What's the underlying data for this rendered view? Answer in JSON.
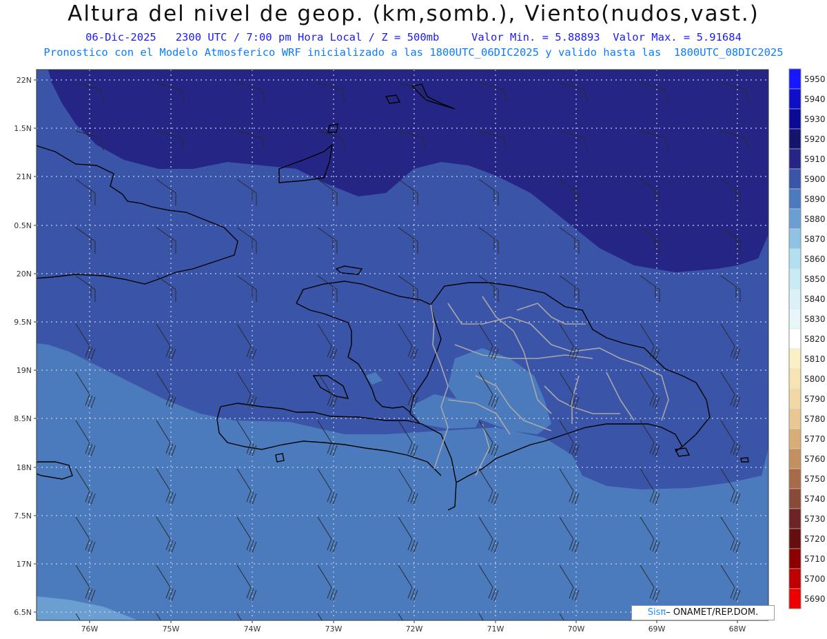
{
  "header": {
    "title": "Altura del nivel de geop. (km,somb.), Viento(nudos,vast.)",
    "line1": "06-Dic-2025   2300 UTC / 7:00 pm Hora Local / Z = 500mb     Valor Min. = 5.88893  Valor Max. = 5.91684",
    "line2": "Pronostico con el Modelo Atmosferico WRF inicializado a las 1800UTC_06DIC2025 y valido hasta las  1800UTC_08DIC2025"
  },
  "credit": {
    "prefix": "Sis",
    "pi": "π",
    "suffix": "– ONAMET/REP.DOM."
  },
  "map": {
    "lat_labels": [
      "22N",
      "1.5N",
      "21N",
      "0.5N",
      "20N",
      "9.5N",
      "19N",
      "8.5N",
      "18N",
      "7.5N",
      "17N",
      "6.5N"
    ],
    "lon_labels": [
      "76W",
      "75W",
      "74W",
      "73W",
      "72W",
      "71W",
      "70W",
      "69W",
      "68W"
    ]
  },
  "colorbar": {
    "levels": [
      "5950",
      "5940",
      "5930",
      "5920",
      "5910",
      "5900",
      "5890",
      "5880",
      "5870",
      "5860",
      "5850",
      "5840",
      "5830",
      "5820",
      "5810",
      "5800",
      "5790",
      "5780",
      "5770",
      "5760",
      "5750",
      "5740",
      "5730",
      "5720",
      "5710",
      "5700",
      "5690"
    ],
    "colors": [
      "#1616ff",
      "#0e0ec8",
      "#0a0a96",
      "#14146e",
      "#252585",
      "#3a54a8",
      "#4b7bbd",
      "#6b9fd1",
      "#8ec3e3",
      "#b3dff0",
      "#c8ebf5",
      "#daf1f8",
      "#e6f6f9",
      "#ffffff",
      "#fbefc6",
      "#f6e4b5",
      "#f1d8a5",
      "#e9c793",
      "#d9ad78",
      "#c4905f",
      "#a86b4a",
      "#8a4a38",
      "#6e2424",
      "#640e0e",
      "#8c0000",
      "#c00000",
      "#ee0000"
    ]
  },
  "fields": {
    "colors": {
      "z5910": "#252585",
      "z5900": "#3a54a8",
      "z5890": "#4b7bbd",
      "z5880": "#6b9fd1"
    }
  }
}
